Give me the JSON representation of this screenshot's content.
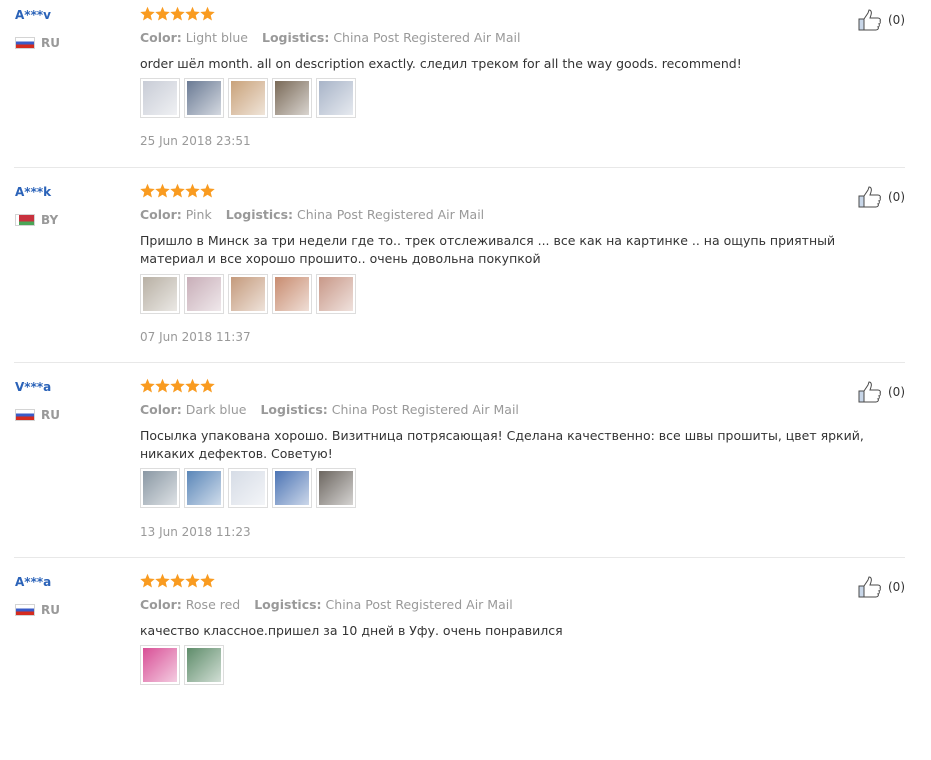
{
  "labels": {
    "color": "Color:",
    "logistics": "Logistics:"
  },
  "colors": {
    "star": "#f99b20",
    "buyer_name": "#2a62b8",
    "muted_text": "#999999",
    "body_text": "#333333",
    "like_icon_fill": "#c8d6e8",
    "like_icon_stroke": "#4a4a4a"
  },
  "icons": {
    "stars": "star-icon",
    "helpful": "thumb-up-icon",
    "flag": "flag-icon"
  },
  "reviews": [
    {
      "buyer": "A***v",
      "country": "RU",
      "rating": 5,
      "color": "Light blue",
      "logistics": "China Post Registered Air Mail",
      "text": "order шёл month. all on description exactly. следил треком for all the way goods. recommend!",
      "date": "25 Jun 2018 23:51",
      "helpful_count": "(0)",
      "photos": [
        "#c8ccd6",
        "#6a7a94",
        "#c9a27a",
        "#7a6a58",
        "#a8b4c8"
      ]
    },
    {
      "buyer": "A***k",
      "country": "BY",
      "rating": 5,
      "color": "Pink",
      "logistics": "China Post Registered Air Mail",
      "text": "Пришло в Минск за три недели где то.. трек отслеживался ... все как на картинке .. на ощупь приятный материал и все хорошо прошито.. очень довольна покупкой",
      "date": "07 Jun 2018 11:37",
      "helpful_count": "(0)",
      "photos": [
        "#b8b0a4",
        "#c8aeb8",
        "#c49a7c",
        "#c88c70",
        "#c89888"
      ]
    },
    {
      "buyer": "V***a",
      "country": "RU",
      "rating": 5,
      "color": "Dark blue",
      "logistics": "China Post Registered Air Mail",
      "text": "Посылка упакована хорошо. Визитница потрясающая! Сделана качественно: все швы прошиты, цвет яркий, никаких дефектов. Советую!",
      "date": "13 Jun 2018 11:23",
      "helpful_count": "(0)",
      "photos": [
        "#8a98a4",
        "#5a86b8",
        "#d6dce6",
        "#4c74b4",
        "#6c6660"
      ]
    },
    {
      "buyer": "A***a",
      "country": "RU",
      "rating": 5,
      "color": "Rose red",
      "logistics": "China Post Registered Air Mail",
      "text": "качество классное.пришел за 10 дней в Уфу. очень понравился",
      "date": "",
      "helpful_count": "(0)",
      "photos": [
        "#d84f96",
        "#5e8c6a"
      ]
    }
  ]
}
